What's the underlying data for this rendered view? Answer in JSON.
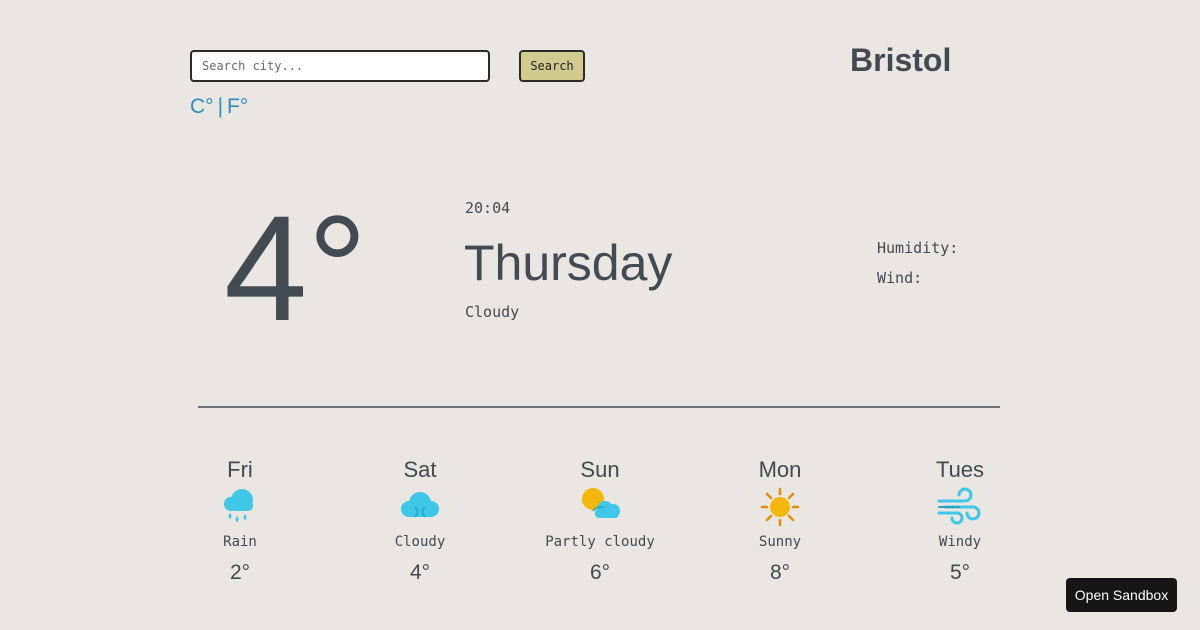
{
  "search": {
    "placeholder": "Search city...",
    "value": "",
    "button_label": "Search"
  },
  "location": {
    "city": "Bristol"
  },
  "units": {
    "celsius_label": "C°",
    "separator": "|",
    "fahrenheit_label": "F°"
  },
  "current": {
    "temperature": "4°",
    "time": "20:04",
    "day": "Thursday",
    "condition": "Cloudy",
    "humidity_label": "Humidity:",
    "wind_label": "Wind:"
  },
  "forecast": [
    {
      "day": "Fri",
      "icon": "rain-icon",
      "condition": "Rain",
      "temp": "2°"
    },
    {
      "day": "Sat",
      "icon": "cloudy-icon",
      "condition": "Cloudy",
      "temp": "4°"
    },
    {
      "day": "Sun",
      "icon": "partly-cloudy-icon",
      "condition": "Partly cloudy",
      "temp": "6°"
    },
    {
      "day": "Mon",
      "icon": "sunny-icon",
      "condition": "Sunny",
      "temp": "8°"
    },
    {
      "day": "Tues",
      "icon": "windy-icon",
      "condition": "Windy",
      "temp": "5°"
    }
  ],
  "sandbox": {
    "label": "Open Sandbox"
  },
  "colors": {
    "background": "#eae6e1",
    "text": "#424a52",
    "link": "#2a8fbf",
    "search_button": "#d2cb8f",
    "cloud": "#3ec7e6",
    "sun": "#f5b70a"
  }
}
